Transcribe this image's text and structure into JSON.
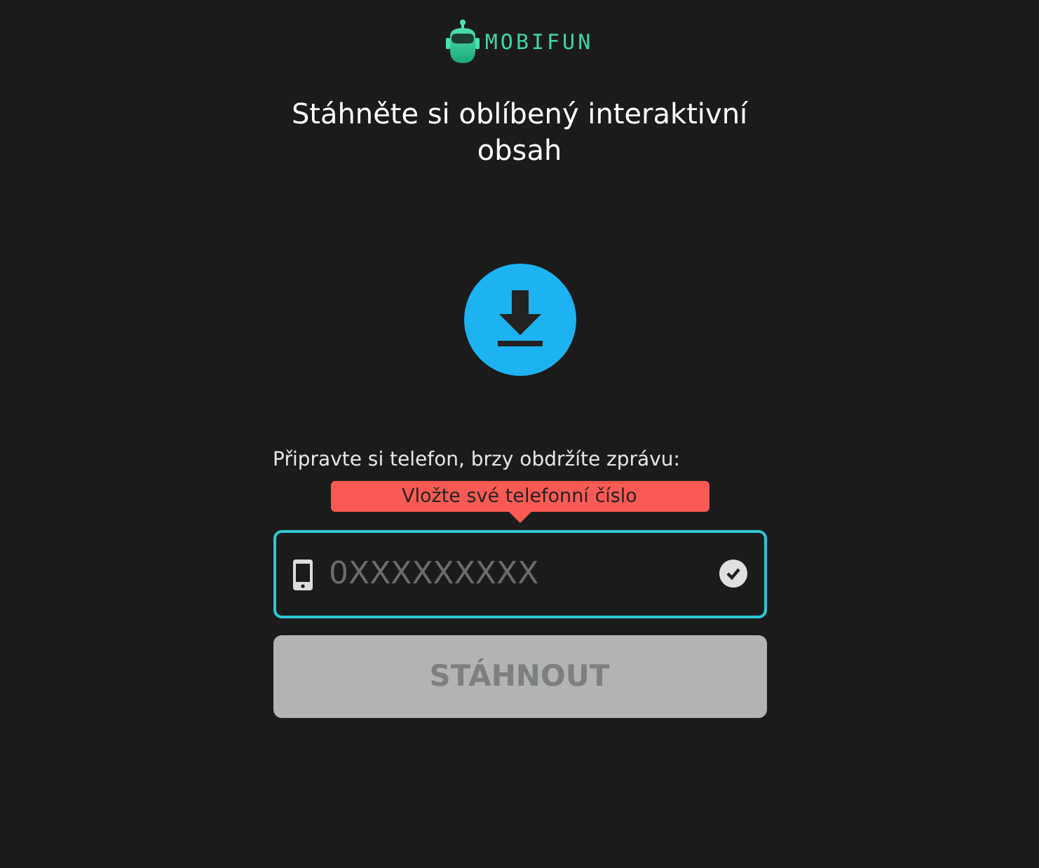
{
  "logo": {
    "text": "MOBIFUN"
  },
  "heading": "Stáhněte si oblíbený interaktivní obsah",
  "prompt": "Připravte si telefon, brzy obdržíte zprávu:",
  "tooltip": "Vložte své telefonní číslo",
  "phone_field": {
    "placeholder": "0XXXXXXXXX",
    "valid": true
  },
  "download_button": {
    "label": "STÁHNOUT",
    "disabled": true
  }
}
